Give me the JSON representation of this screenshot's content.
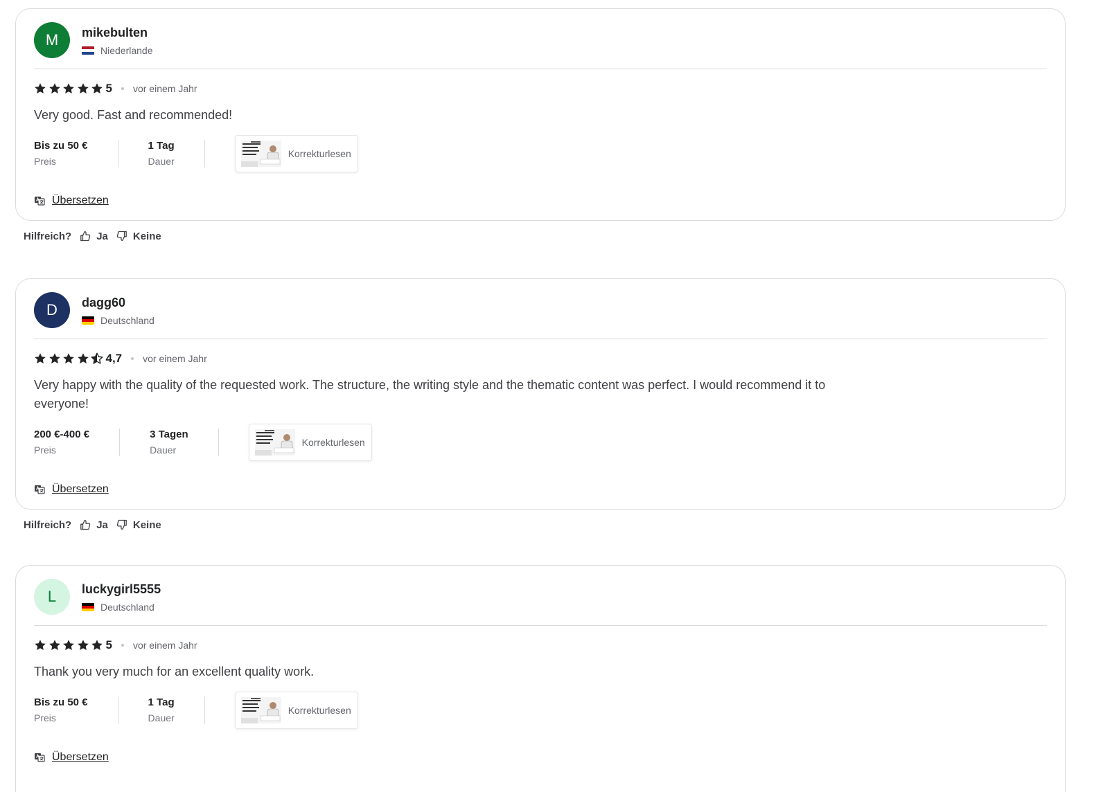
{
  "reviews": [
    {
      "avatar_letter": "M",
      "avatar_bg": "#0e7d36",
      "avatar_fg": "#ffffff",
      "username": "mikebulten",
      "country": "Niederlande",
      "flag_colors": [
        "#ae1c28",
        "#ffffff",
        "#21468b"
      ],
      "rating_value": "5",
      "stars": [
        1,
        1,
        1,
        1,
        1
      ],
      "time_ago": "vor einem Jahr",
      "text": "Very good. Fast and recommended!",
      "price": "Bis zu 50 €",
      "price_label": "Preis",
      "duration": "1 Tag",
      "duration_label": "Dauer",
      "service_label": "Korrekturlesen",
      "translate_label": "Übersetzen",
      "helpful_label": "Hilfreich?",
      "yes_label": "Ja",
      "no_label": "Keine"
    },
    {
      "avatar_letter": "D",
      "avatar_bg": "#1e3163",
      "avatar_fg": "#ffffff",
      "username": "dagg60",
      "country": "Deutschland",
      "flag_colors": [
        "#000000",
        "#dd0000",
        "#ffce00"
      ],
      "rating_value": "4,7",
      "stars": [
        1,
        1,
        1,
        1,
        0.5
      ],
      "time_ago": "vor einem Jahr",
      "text": "Very happy with the quality of the requested work. The structure, the writing style and the thematic content was perfect. I would recommend it to everyone!",
      "price": "200 €-400 €",
      "price_label": "Preis",
      "duration": "3 Tagen",
      "duration_label": "Dauer",
      "service_label": "Korrekturlesen",
      "translate_label": "Übersetzen",
      "helpful_label": "Hilfreich?",
      "yes_label": "Ja",
      "no_label": "Keine"
    },
    {
      "avatar_letter": "L",
      "avatar_bg": "#d3f5e1",
      "avatar_fg": "#0e7d36",
      "username": "luckygirl5555",
      "country": "Deutschland",
      "flag_colors": [
        "#000000",
        "#dd0000",
        "#ffce00"
      ],
      "rating_value": "5",
      "stars": [
        1,
        1,
        1,
        1,
        1
      ],
      "time_ago": "vor einem Jahr",
      "text": "Thank you very much for an excellent quality work.",
      "price": "Bis zu 50 €",
      "price_label": "Preis",
      "duration": "1 Tag",
      "duration_label": "Dauer",
      "service_label": "Korrekturlesen",
      "translate_label": "Übersetzen"
    }
  ]
}
